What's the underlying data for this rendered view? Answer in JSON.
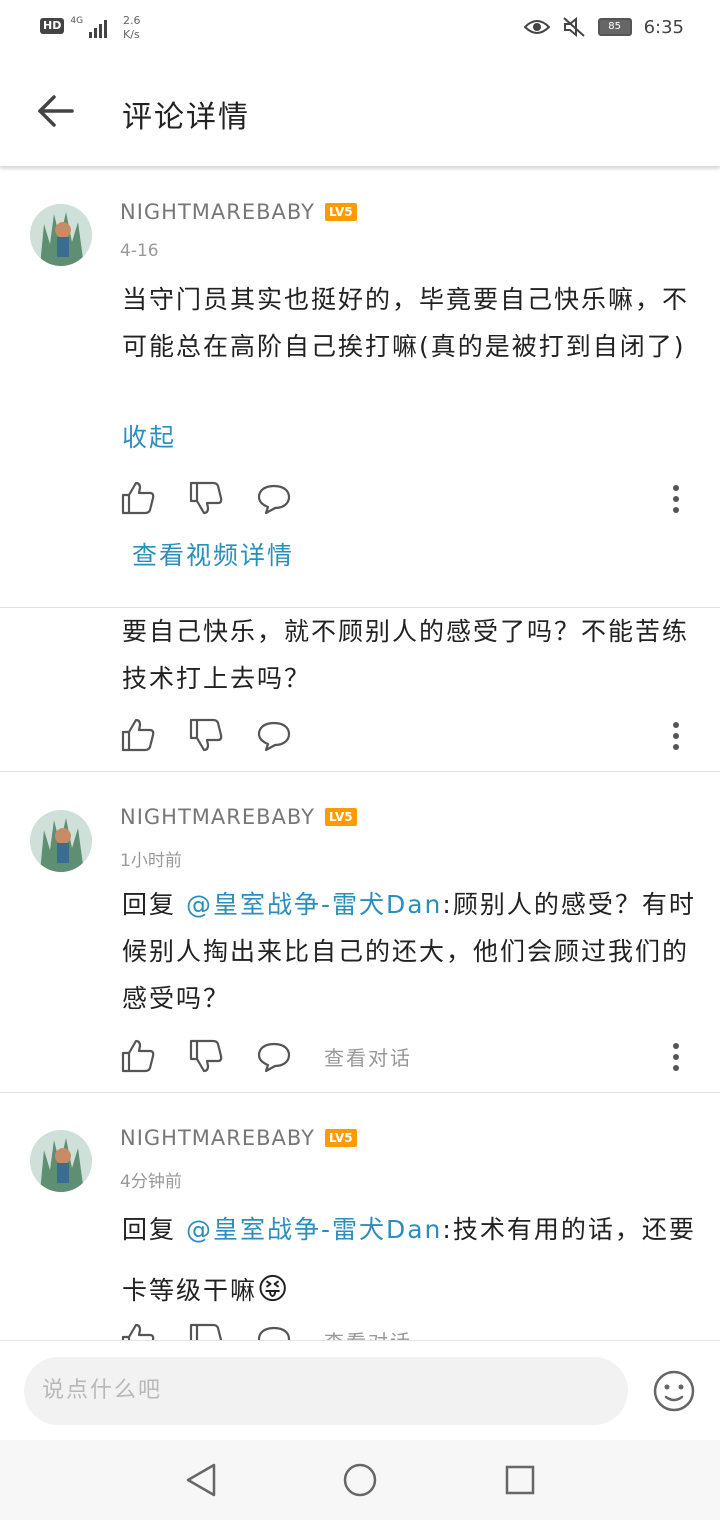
{
  "status_bar": {
    "hd": "HD",
    "network": "4G",
    "speed_value": "2.6",
    "speed_unit": "K/s",
    "battery": "85",
    "time": "6:35"
  },
  "header": {
    "title": "评论详情"
  },
  "comments": [
    {
      "username": "NIGHTMAREBABY",
      "level": "LV5",
      "time": "4-16",
      "text": "当守门员其实也挺好的，毕竟要自己快乐嘛，不可能总在高阶自己挨打嘛(真的是被打到自闭了)",
      "collapse_label": "收起",
      "view_video_label": "查看视频详情"
    },
    {
      "text": "要自己快乐，就不顾别人的感受了吗？不能苦练技术打上去吗？"
    },
    {
      "username": "NIGHTMAREBABY",
      "level": "LV5",
      "time": "1小时前",
      "reply_prefix": "回复 ",
      "mention": "@皇室战争-雷犬Dan",
      "text": ":顾别人的感受？有时候别人掏出来比自己的还大，他们会顾过我们的感受吗？",
      "view_conversation_label": "查看对话"
    },
    {
      "username": "NIGHTMAREBABY",
      "level": "LV5",
      "time": "4分钟前",
      "reply_prefix": "回复 ",
      "mention": "@皇室战争-雷犬Dan",
      "text": ":技术有用的话，还要卡等级干嘛",
      "emoji": "😝",
      "view_conversation_label": "查看对话"
    }
  ],
  "input": {
    "placeholder": "说点什么吧"
  },
  "icons": {
    "like": "thumb-up-icon",
    "dislike": "thumb-down-icon",
    "reply": "chat-bubble-icon",
    "more": "more-vertical-icon",
    "emoji": "smiley-icon"
  },
  "colors": {
    "accent": "#2a8fbd",
    "level_badge": "#ff9b00"
  }
}
